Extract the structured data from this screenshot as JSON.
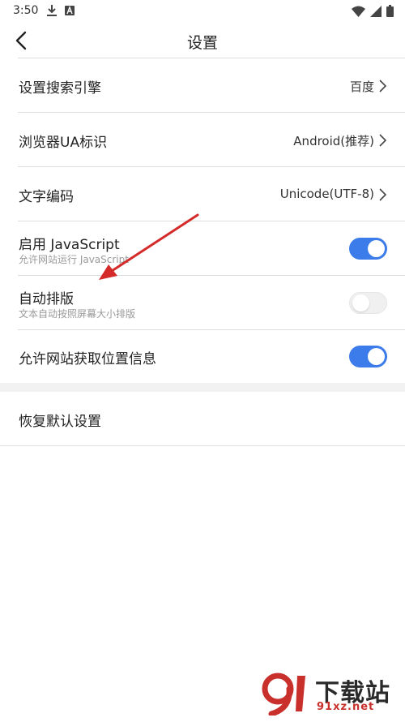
{
  "status_bar": {
    "time": "3:50",
    "icons_left": [
      "download-icon",
      "a-box-icon"
    ],
    "icons_right": [
      "wifi-icon",
      "signal-icon",
      "battery-icon"
    ]
  },
  "header": {
    "title": "设置",
    "back_icon": "chevron-left-icon"
  },
  "settings": [
    {
      "id": "search-engine",
      "title": "设置搜索引擎",
      "value": "百度"
    },
    {
      "id": "ua",
      "title": "浏览器UA标识",
      "value": "Android(推荐)"
    },
    {
      "id": "encoding",
      "title": "文字编码",
      "value": "Unicode(UTF-8)"
    },
    {
      "id": "javascript",
      "title": "启用 JavaScript",
      "subtitle": "允许网站运行 JavaScript",
      "toggle": true
    },
    {
      "id": "auto-layout",
      "title": "自动排版",
      "subtitle": "文本自动按照屏幕大小排版",
      "toggle": false
    },
    {
      "id": "location",
      "title": "允许网站获取位置信息",
      "toggle": true
    }
  ],
  "reset": {
    "title": "恢复默认设置"
  },
  "colors": {
    "toggle_on": "#3c7bea",
    "toggle_off": "#f0f0f0",
    "arrow": "#d42a2a",
    "watermark_red": "#c9302c"
  },
  "watermark": {
    "text": "下载站",
    "url": "91xz.net"
  }
}
